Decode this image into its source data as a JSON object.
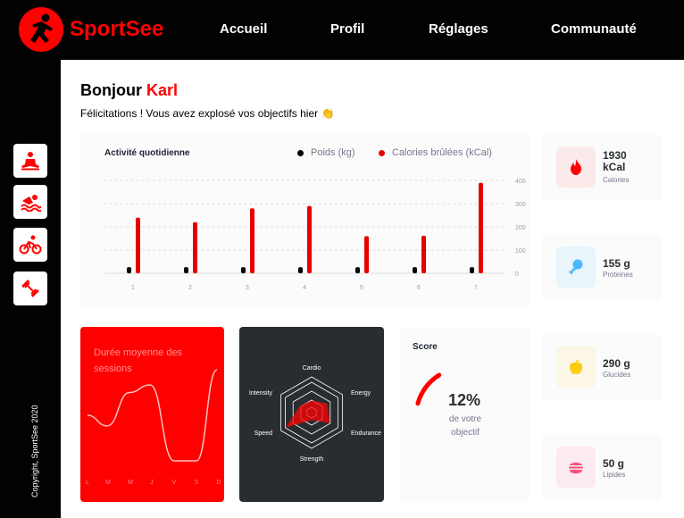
{
  "brand": {
    "name": "SportSee"
  },
  "nav": [
    "Accueil",
    "Profil",
    "Réglages",
    "Communauté"
  ],
  "sidebar": {
    "icons": [
      "meditation-icon",
      "swimming-icon",
      "cycling-icon",
      "dumbbell-icon"
    ],
    "copyright": "Copyright, SportSee 2020"
  },
  "greeting": {
    "hello": "Bonjour",
    "name": "Karl"
  },
  "subtitle": "Félicitations ! Vous avez explosé vos objectifs hier 👏",
  "activity": {
    "title": "Activité quotidienne",
    "legend": {
      "weight": "Poids (kg)",
      "calories": "Calories brûlées (kCal)"
    }
  },
  "key_data": [
    {
      "value": "1930 kCal",
      "label": "Calories",
      "icon": "fire-icon",
      "bg": "#fbeaea"
    },
    {
      "value": "155 g",
      "label": "Proteines",
      "icon": "drumstick-icon",
      "bg": "#e9f4fb"
    },
    {
      "value": "290 g",
      "label": "Glucides",
      "icon": "apple-icon",
      "bg": "#fbf6e5"
    },
    {
      "value": "50 g",
      "label": "Lipides",
      "icon": "burger-icon",
      "bg": "#fbeaef"
    }
  ],
  "sessions": {
    "title": "Durée moyenne des sessions"
  },
  "radar": {
    "labels": [
      "Cardio",
      "Energy",
      "Endurance",
      "Strength",
      "Speed",
      "Intensity"
    ]
  },
  "score": {
    "title": "Score",
    "percent": "12%",
    "subtitle_1": "de votre",
    "subtitle_2": "objectif",
    "value": 0.12
  },
  "colors": {
    "accent": "#ff0101",
    "dark": "#020203",
    "panel": "#282d30"
  },
  "chart_data": [
    {
      "type": "bar",
      "title": "Activité quotidienne",
      "categories": [
        "1",
        "2",
        "3",
        "4",
        "5",
        "6",
        "7"
      ],
      "series": [
        {
          "name": "Poids (kg)",
          "values": [
            70,
            70,
            70,
            70,
            70,
            70,
            70
          ],
          "color": "#282d30",
          "axis": "hidden"
        },
        {
          "name": "Calories brûlées (kCal)",
          "values": [
            240,
            220,
            280,
            290,
            160,
            162,
            390
          ],
          "color": "#e60000",
          "axis": "right"
        }
      ],
      "y_ticks": [
        "0",
        "100",
        "200",
        "300",
        "400"
      ],
      "ylim": [
        0,
        400
      ],
      "grid": "horizontal dashed",
      "legend": "top-right"
    },
    {
      "type": "line",
      "title": "Durée moyenne des sessions",
      "categories": [
        "L",
        "M",
        "M",
        "J",
        "V",
        "S",
        "D"
      ],
      "values": [
        30,
        23,
        45,
        50,
        0,
        0,
        60
      ]
    },
    {
      "type": "radar",
      "categories": [
        "Intensity",
        "Speed",
        "Strength",
        "Endurance",
        "Energy",
        "Cardio"
      ],
      "values": [
        90,
        200,
        50,
        140,
        120,
        80
      ],
      "max": 250
    },
    {
      "type": "pie",
      "title": "Score",
      "values": [
        12,
        88
      ]
    }
  ]
}
